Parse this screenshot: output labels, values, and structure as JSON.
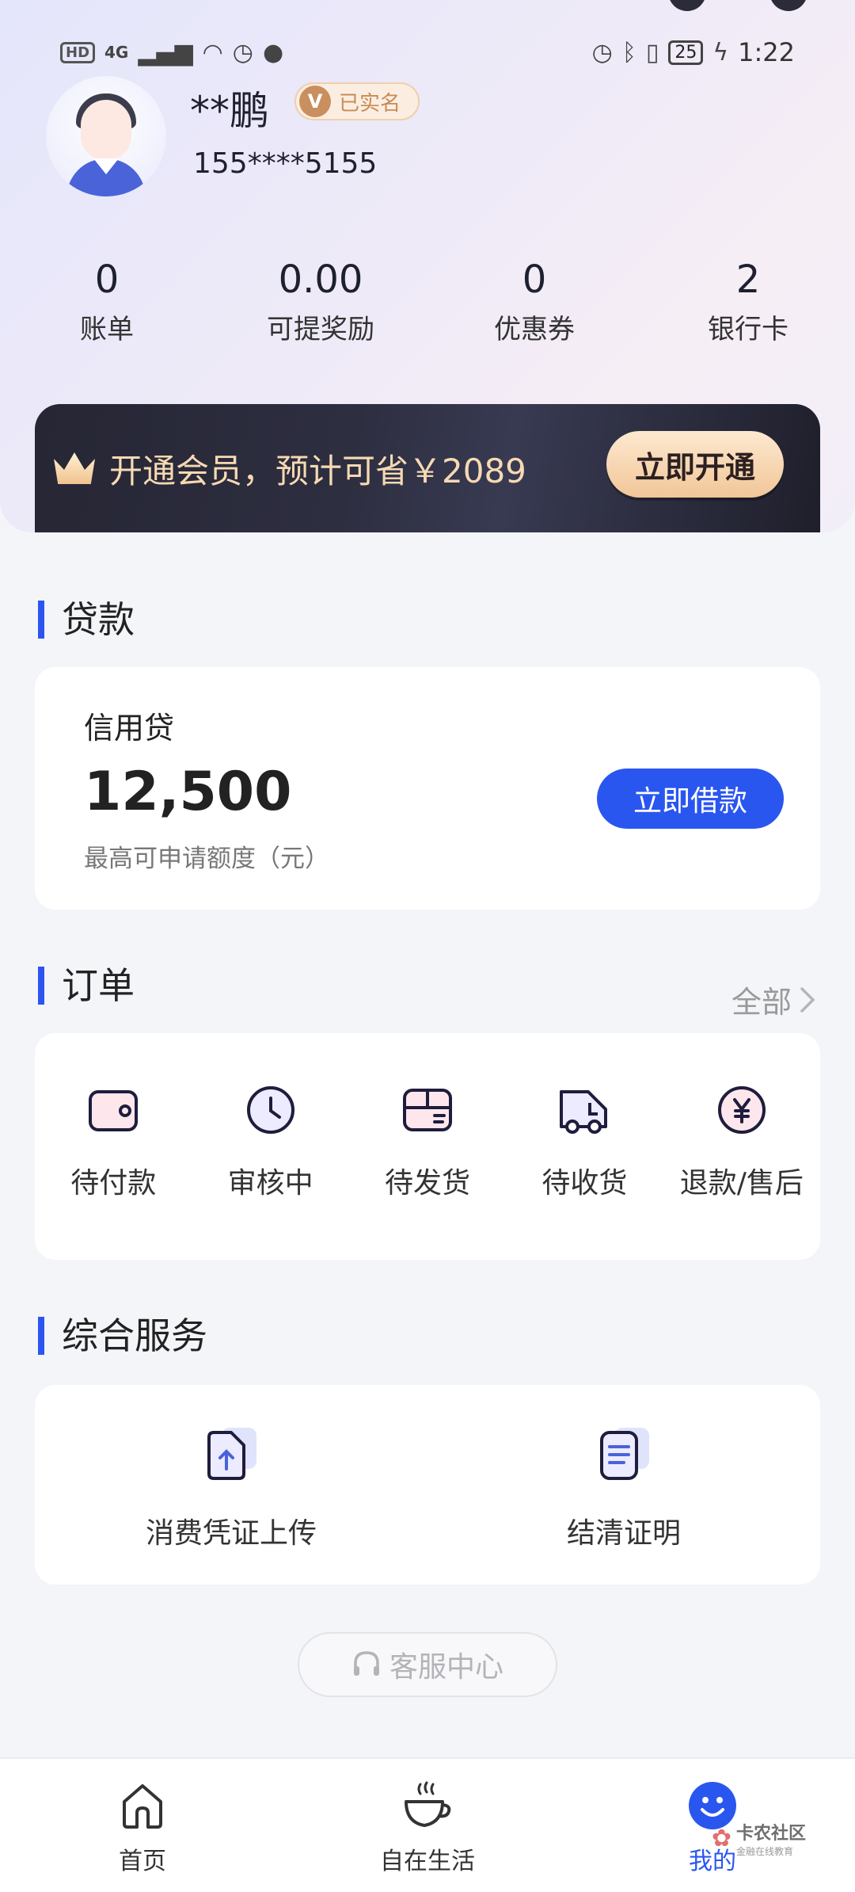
{
  "status_bar": {
    "left_label": "HD",
    "network": "4G",
    "time": "1:22",
    "battery": "25"
  },
  "profile": {
    "name": "**鹏",
    "verified_badge_letter": "V",
    "verified_label": "已实名",
    "phone": "155****5155"
  },
  "stats": [
    {
      "value": "0",
      "label": "账单"
    },
    {
      "value": "0.00",
      "label": "可提奖励"
    },
    {
      "value": "0",
      "label": "优惠券"
    },
    {
      "value": "2",
      "label": "银行卡"
    }
  ],
  "vip": {
    "text": "开通会员，预计可省￥2089",
    "button": "立即开通"
  },
  "loan": {
    "section_title": "贷款",
    "product_name": "信用贷",
    "amount": "12,500",
    "subtitle": "最高可申请额度（元）",
    "button": "立即借款"
  },
  "orders": {
    "section_title": "订单",
    "all_label": "全部",
    "items": [
      {
        "label": "待付款",
        "icon": "wallet-icon"
      },
      {
        "label": "审核中",
        "icon": "clock-icon"
      },
      {
        "label": "待发货",
        "icon": "package-icon"
      },
      {
        "label": "待收货",
        "icon": "truck-icon"
      },
      {
        "label": "退款/售后",
        "icon": "yuan-refund-icon"
      }
    ]
  },
  "services": {
    "section_title": "综合服务",
    "items": [
      {
        "label": "消费凭证上传",
        "icon": "upload-document-icon"
      },
      {
        "label": "结清证明",
        "icon": "document-icon"
      }
    ]
  },
  "customer_service": {
    "label": "客服中心"
  },
  "tabbar": {
    "items": [
      {
        "label": "首页",
        "icon": "home-icon"
      },
      {
        "label": "自在生活",
        "icon": "coffee-cup-icon"
      },
      {
        "label": "我的",
        "icon": "smiley-icon"
      }
    ],
    "active_index": 2
  },
  "watermark": {
    "text": "卡农社区",
    "subtext": "金融在线教育"
  },
  "colors": {
    "accent": "#2a56f0",
    "vip_gold": "#f7d9b3",
    "vip_dark": "#262634"
  }
}
